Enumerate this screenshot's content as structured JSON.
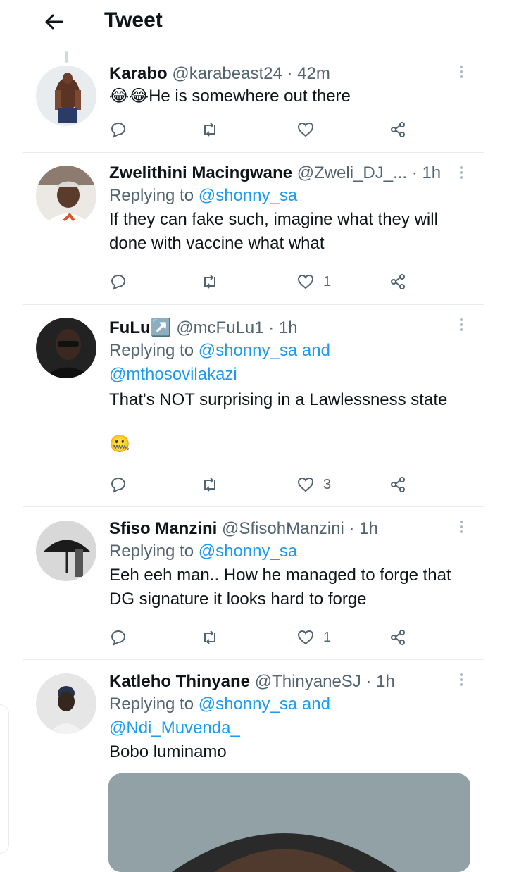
{
  "header": {
    "title": "Tweet",
    "back_icon": "arrow-left-icon"
  },
  "tweets": [
    {
      "name": "Karabo",
      "handle": "@karabeast24",
      "time": "· 42m",
      "text": "😂😂He is somewhere out there",
      "likes": ""
    },
    {
      "name": "Zwelithini Macingwane",
      "handle": "@Zweli_DJ_...",
      "time": "· 1h",
      "replying_prefix": "Replying to",
      "replying_to": "@shonny_sa",
      "text_1": "If they can fake such, imagine what they will",
      "text_2": "done with vaccine what what",
      "likes": "1"
    },
    {
      "name": "FuLu↗️",
      "handle": "@mcFuLu1",
      "time": "· 1h",
      "replying_prefix": "Replying to",
      "replying_to": "@shonny_sa and",
      "replying_to_2": "@mthosovilakazi",
      "text_1": "That's NOT surprising in a Lawlessness state",
      "text_2": "🤐",
      "likes": "3"
    },
    {
      "name": "Sfiso Manzini",
      "handle": "@SfisohManzini",
      "time": "· 1h",
      "replying_prefix": "Replying to",
      "replying_to": "@shonny_sa",
      "text_1": "Eeh eeh man.. How he managed to forge that",
      "text_2": "DG signature it looks hard to forge",
      "likes": "1"
    },
    {
      "name": "Katleho Thinyane",
      "handle": "@ThinyaneSJ",
      "time": "· 1h",
      "replying_prefix": "Replying to",
      "replying_to": "@shonny_sa and",
      "replying_to_2": "@Ndi_Muvenda_",
      "text_1": "Bobo luminamo"
    }
  ],
  "icons": {
    "reply": "reply-icon",
    "retweet": "retweet-icon",
    "like": "like-icon",
    "share": "share-icon",
    "more": "more-icon"
  }
}
